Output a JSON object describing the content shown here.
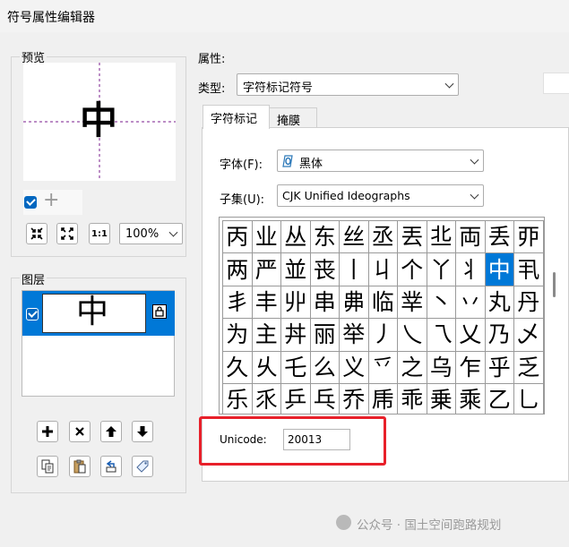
{
  "window": {
    "title": "符号属性编辑器"
  },
  "preview": {
    "label": "预览",
    "glyph": "中",
    "zoom": "100%",
    "zoom_fit_1": "1:1"
  },
  "layers": {
    "label": "图层",
    "glyph": "中"
  },
  "properties": {
    "label": "属性:",
    "type_label": "类型:",
    "type_value": "字符标记符号"
  },
  "tabs": [
    {
      "label": "字符标记"
    },
    {
      "label": "掩膜"
    }
  ],
  "charmark": {
    "font_label": "字体(F):",
    "font_value": "黑体",
    "subset_label": "子集(U):",
    "subset_value": "CJK Unified Ideographs",
    "unicode_label": "Unicode:",
    "unicode_value": "20013"
  },
  "grid": {
    "rows": [
      [
        "丙",
        "业",
        "丛",
        "东",
        "丝",
        "丞",
        "丟",
        "丠",
        "両",
        "丢",
        "丣"
      ],
      [
        "两",
        "严",
        "並",
        "丧",
        "丨",
        "丩",
        "个",
        "丫",
        "丬",
        "中",
        "丮"
      ],
      [
        "丯",
        "丰",
        "丱",
        "串",
        "丳",
        "临",
        "丵",
        "丶",
        "丷",
        "丸",
        "丹"
      ],
      [
        "为",
        "主",
        "丼",
        "丽",
        "举",
        "丿",
        "乀",
        "乁",
        "乂",
        "乃",
        "乄"
      ],
      [
        "久",
        "乆",
        "乇",
        "么",
        "义",
        "乊",
        "之",
        "乌",
        "乍",
        "乎",
        "乏"
      ],
      [
        "乐",
        "乑",
        "乒",
        "乓",
        "乔",
        "乕",
        "乖",
        "乗",
        "乘",
        "乙",
        "乚"
      ]
    ],
    "selected": "中"
  },
  "watermark": {
    "text": "公众号 · 国土空间跑路规划"
  },
  "colors": {
    "accent": "#0078d7",
    "highlight": "#e8202a"
  }
}
